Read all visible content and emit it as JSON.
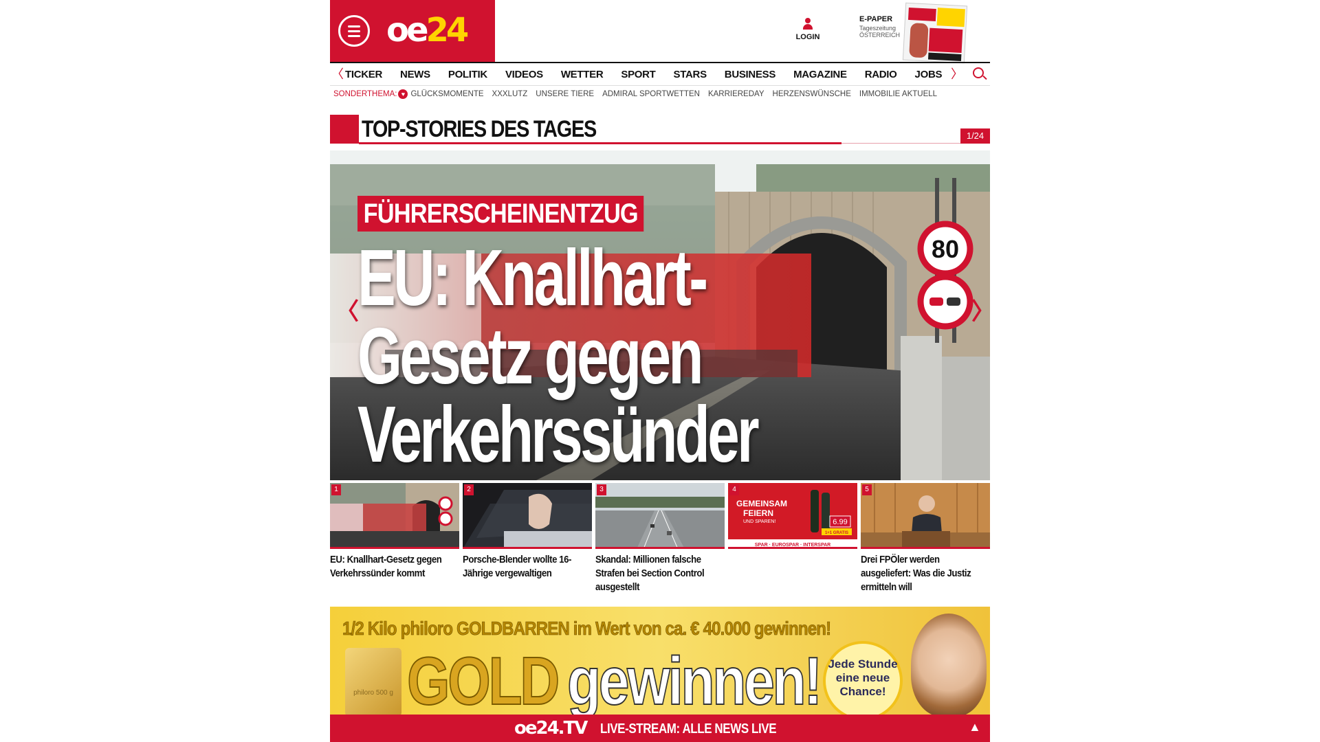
{
  "header": {
    "logo": "oe24",
    "login_label": "LOGIN",
    "epaper": {
      "title": "E-PAPER",
      "line2": "Tageszeitung",
      "line3": "ÖSTERREICH"
    }
  },
  "nav": {
    "items": [
      "TICKER",
      "NEWS",
      "POLITIK",
      "VIDEOS",
      "WETTER",
      "SPORT",
      "STARS",
      "BUSINESS",
      "MAGAZINE",
      "RADIO",
      "JOBS"
    ],
    "left_arrow": "〈",
    "right_arrow": "〉"
  },
  "subnav": {
    "label": "SONDERTHEMA:",
    "items": [
      "GLÜCKSMOMENTE",
      "XXXLUTZ",
      "UNSERE TIERE",
      "ADMIRAL SPORTWETTEN",
      "KARRIEREDAY",
      "HERZENSWÜNSCHE",
      "IMMOBILIE AKTUELL"
    ]
  },
  "section": {
    "title": "TOP-STORIES DES TAGES",
    "counter": "1/24"
  },
  "hero": {
    "kicker": "FÜHRERSCHEINENTZUG",
    "headline": "EU: Knallhart-Gesetz gegen Verkehrssünder kommt",
    "sign_speed": "80",
    "arrow_left": "〈",
    "arrow_right": "〉"
  },
  "thumbs": [
    {
      "num": "1",
      "title": "EU: Knallhart-Gesetz gegen Verkehrssünder kommt"
    },
    {
      "num": "2",
      "title": "Porsche-Blender wollte 16-Jährige vergewaltigen"
    },
    {
      "num": "3",
      "title": "Skandal: Millionen falsche Strafen bei Section Control ausgestellt"
    },
    {
      "num": "4",
      "title": ""
    },
    {
      "num": "5",
      "title": "Drei FPÖler werden ausgeliefert: Was die Justiz ermitteln will"
    }
  ],
  "thumb4_ad": {
    "line1": "GEMEINSAM",
    "line2": "FEIERN",
    "line3": "UND SPAREN!",
    "price": "6.99",
    "promo": "1+1 GRATIS",
    "brands": "SPAR · EUROSPAR · INTERSPAR"
  },
  "ad": {
    "top_line": "1/2 Kilo philoro GOLDBARREN im Wert von ca. € 40.000 gewinnen!",
    "gold": "GOLD",
    "gewinnen": "gewinnen!",
    "badge": "Jede Stunde eine neue Chance!",
    "bar_text": "philoro 500 g"
  },
  "livebar": {
    "logo": "oe24.TV",
    "text": "LIVE-STREAM: ALLE NEWS LIVE",
    "arrow": "▲"
  },
  "colors": {
    "brand_red": "#d0122f",
    "logo_yellow": "#ffd400"
  }
}
